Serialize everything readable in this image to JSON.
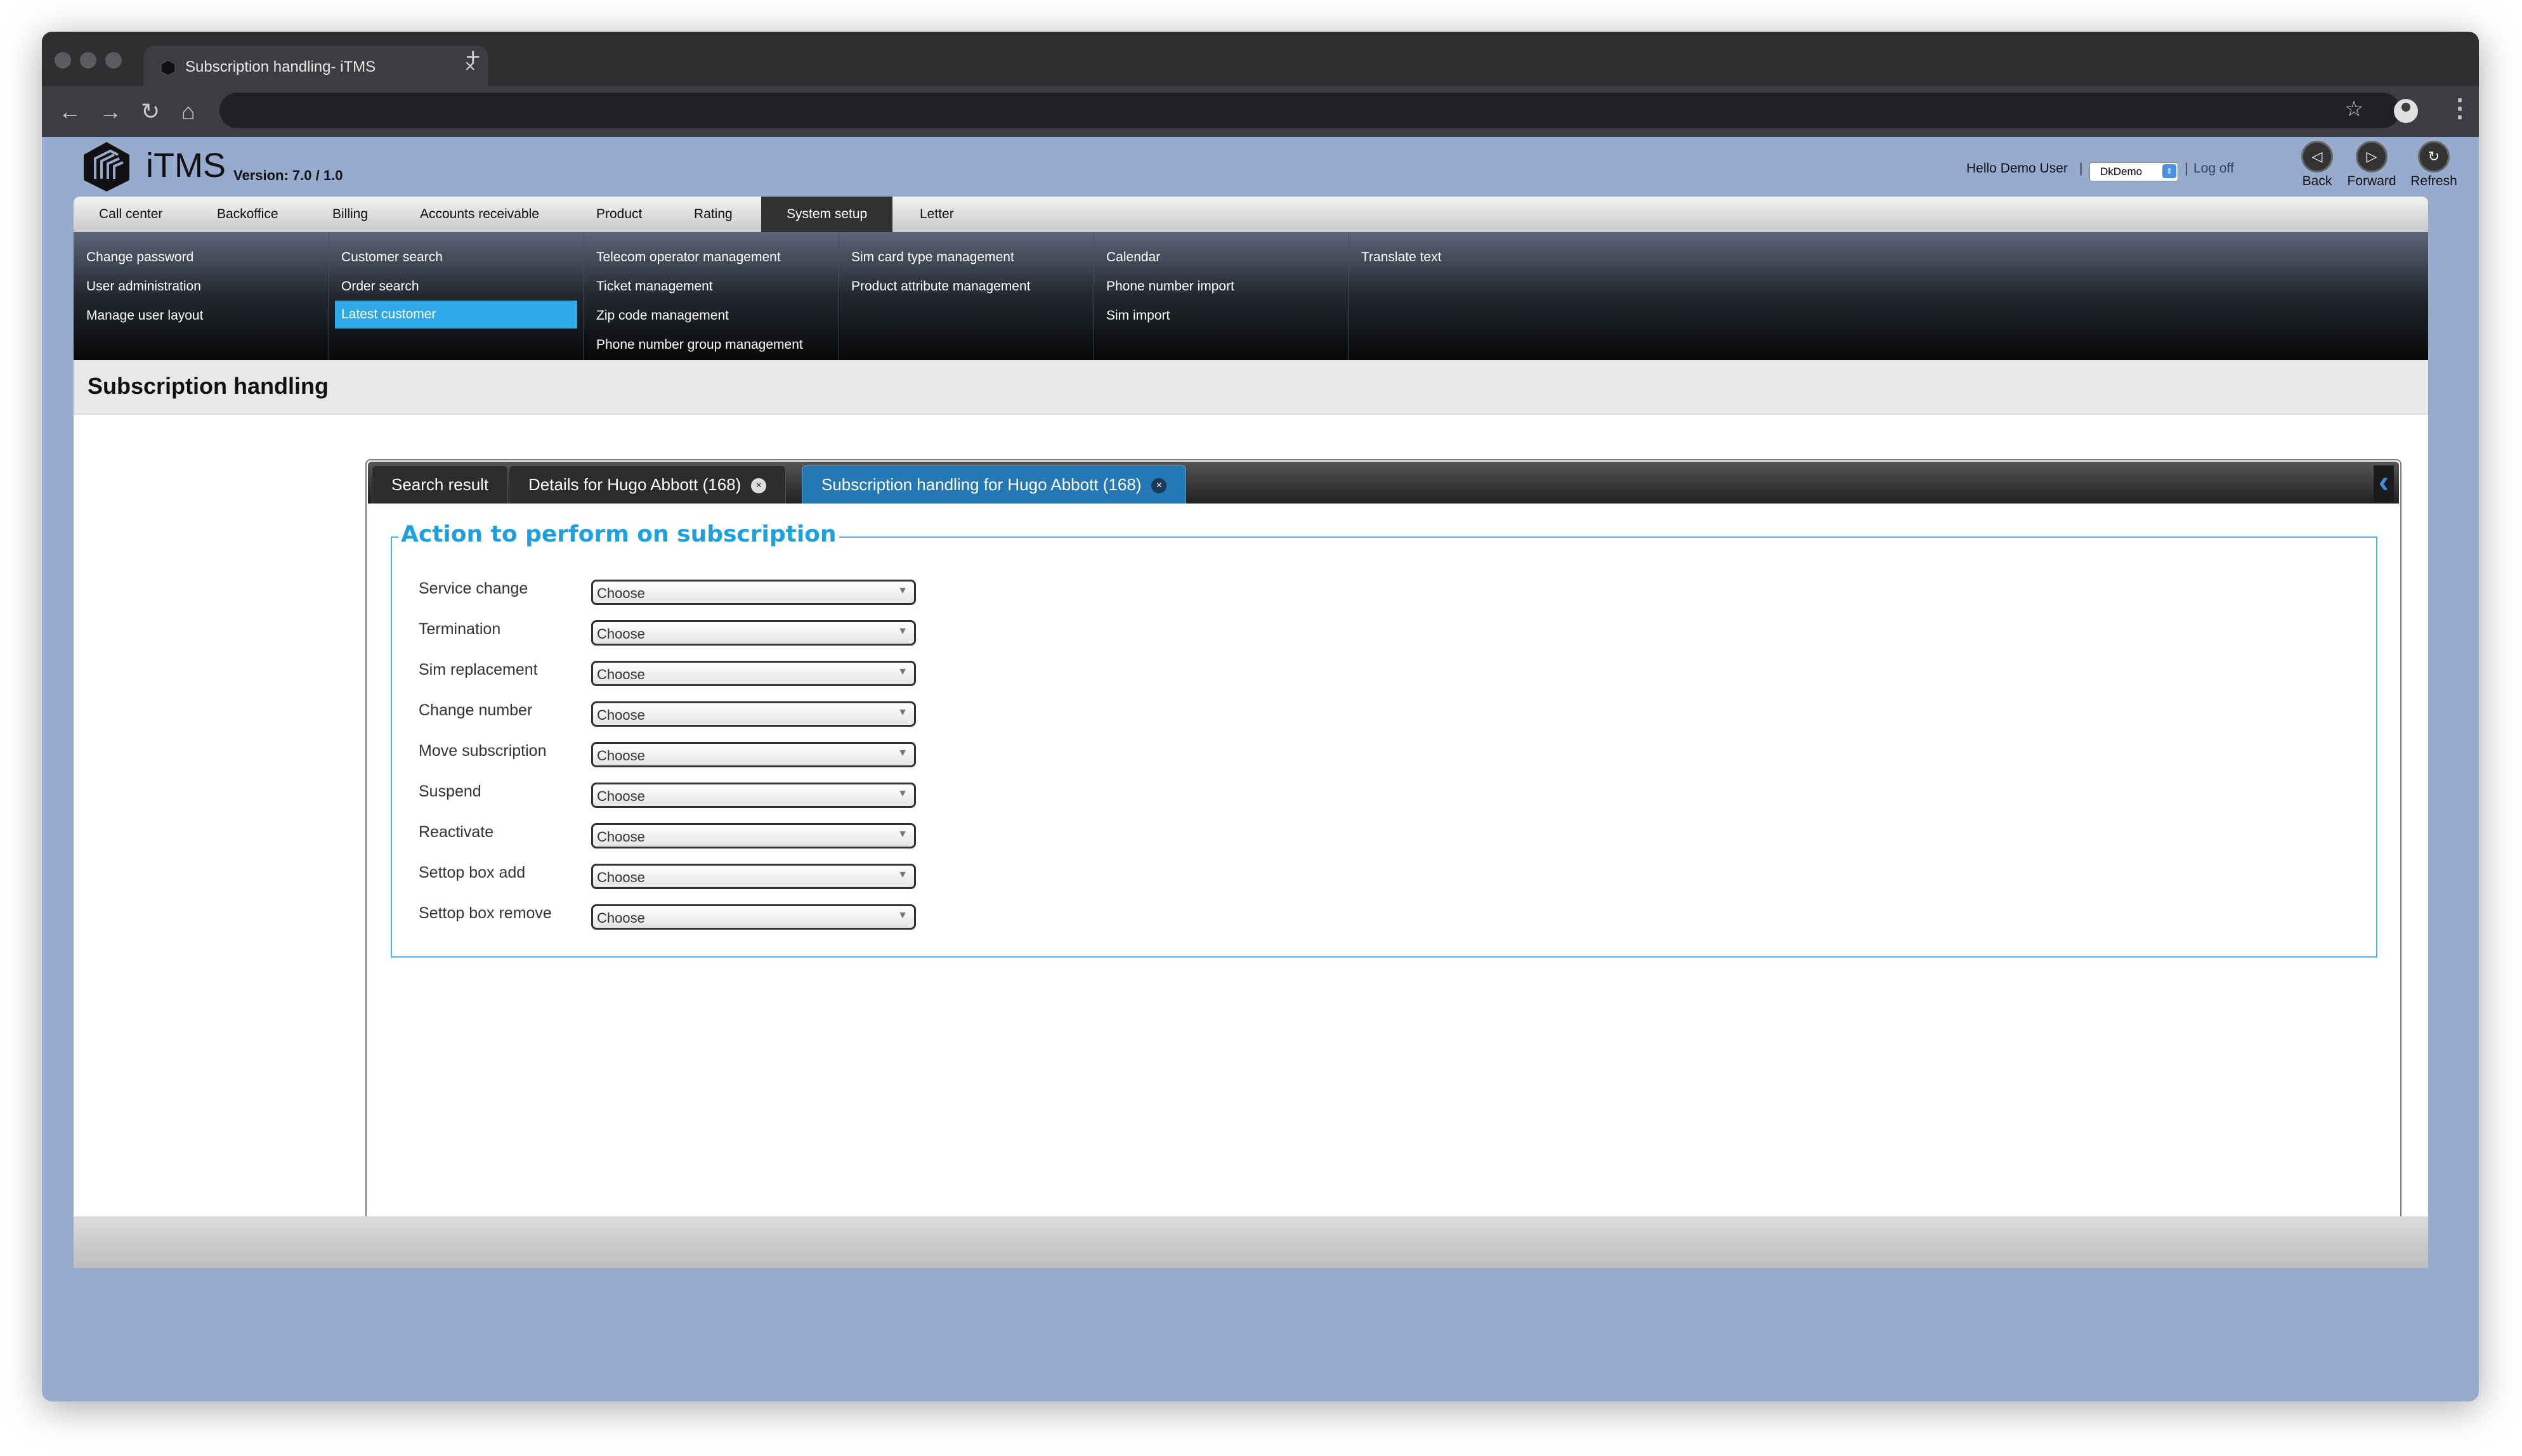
{
  "browser": {
    "tab_title": "Subscription handling- iTMS",
    "tab_close": "×",
    "new_tab": "+"
  },
  "header": {
    "logo_text": "iTMS",
    "version": "Version: 7.0 / 1.0",
    "greeting": "Hello Demo User",
    "separator": "|",
    "user_select_value": "DkDemo",
    "logoff": "Log off",
    "nav": [
      {
        "label": "Back",
        "icon": "back-icon"
      },
      {
        "label": "Forward",
        "icon": "forward-icon"
      },
      {
        "label": "Refresh",
        "icon": "refresh-icon"
      }
    ]
  },
  "menu": {
    "items": [
      "Call center",
      "Backoffice",
      "Billing",
      "Accounts receivable",
      "Product",
      "Rating",
      "System setup",
      "Letter"
    ],
    "active": "System setup"
  },
  "submenu": {
    "columns": [
      [
        "Change password",
        "User administration",
        "Manage user layout"
      ],
      [
        "Customer search",
        "Order search",
        "Latest customer"
      ],
      [
        "Telecom operator management",
        "Ticket management",
        "Zip code management",
        "Phone number group management"
      ],
      [
        "Sim card type management",
        "Product attribute management"
      ],
      [
        "Calendar",
        "Phone number import",
        "Sim import"
      ],
      [
        "Translate text"
      ]
    ],
    "highlighted": "Latest customer"
  },
  "page": {
    "title": "Subscription handling"
  },
  "tabs": [
    {
      "label": "Search result",
      "closable": false
    },
    {
      "label": "Details for Hugo Abbott (168)",
      "closable": true
    },
    {
      "label": "Subscription handling for Hugo Abbott (168)",
      "closable": true,
      "selected": true
    }
  ],
  "form": {
    "legend": "Action to perform on subscription",
    "rows": [
      {
        "label": "Service change",
        "value": "Choose"
      },
      {
        "label": "Termination",
        "value": "Choose"
      },
      {
        "label": "Sim replacement",
        "value": "Choose"
      },
      {
        "label": "Change number",
        "value": "Choose"
      },
      {
        "label": "Move subscription",
        "value": "Choose"
      },
      {
        "label": "Suspend",
        "value": "Choose"
      },
      {
        "label": "Reactivate",
        "value": "Choose"
      },
      {
        "label": "Settop box add",
        "value": "Choose"
      },
      {
        "label": "Settop box remove",
        "value": "Choose"
      }
    ]
  },
  "colors": {
    "accent": "#1d9fe0",
    "highlight": "#2fa9e8",
    "selected_tab": "#2478b4",
    "page_bg": "#97abcf"
  }
}
